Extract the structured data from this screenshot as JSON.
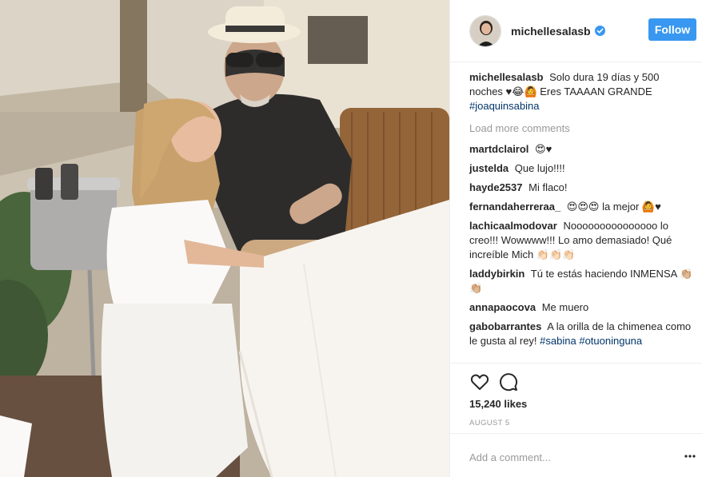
{
  "post": {
    "username": "michellesalasb",
    "verified": true,
    "follow_label": "Follow",
    "caption": {
      "user": "michellesalasb",
      "text": "Solo dura 19 días y 500 noches ♥😂🙆 Eres TAAAAN GRANDE",
      "hashtag": "#joaquinsabina"
    },
    "load_more_label": "Load more comments",
    "comments": [
      {
        "user": "martdclairol",
        "text": "😍♥"
      },
      {
        "user": "justelda",
        "text": "Que lujo!!!!"
      },
      {
        "user": "hayde2537",
        "text": "Mi flaco!"
      },
      {
        "user": "fernandaherreraa_",
        "text": "😍😍😍 la mejor 🙆♥"
      },
      {
        "user": "lachicaalmodovar",
        "text": "Nooooooooooooooo lo creo!!! Wowwww!!! Lo amo demasiado! Qué increíble Mich 👏🏻👏🏻👏🏻"
      },
      {
        "user": "laddybirkin",
        "text": "Tú te estás haciendo INMENSA 👏🏼👏🏼"
      },
      {
        "user": "annapaocova",
        "text": "Me muero"
      },
      {
        "user": "gabobarrantes",
        "text": "A la orilla de la chimenea como le gusta al rey!",
        "hashtags": [
          "#sabina",
          "#otuoninguna"
        ]
      }
    ],
    "likes": "15,240 likes",
    "date": "AUGUST 5",
    "add_comment_placeholder": "Add a comment...",
    "colors": {
      "follow_bg": "#3897f0",
      "hashtag": "#003569",
      "muted": "#999999",
      "verified": "#3897f0"
    },
    "icons": {
      "like": "heart-outline-icon",
      "comment": "speech-bubble-icon",
      "more": "ellipsis-icon",
      "verified": "verified-badge-icon"
    }
  }
}
